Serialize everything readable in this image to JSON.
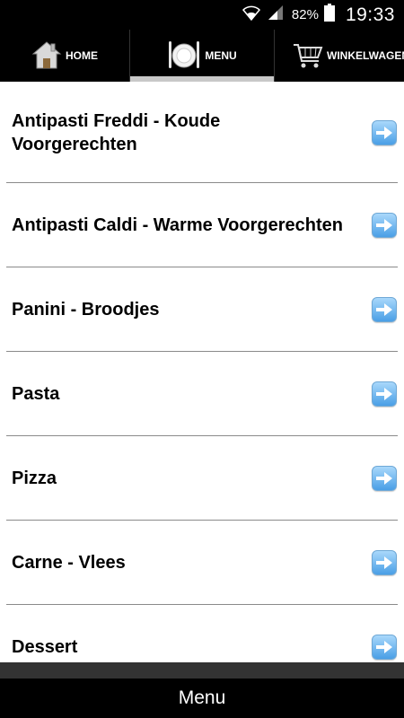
{
  "status": {
    "battery_percent": "82%",
    "time": "19:33",
    "wifi_icon": "wifi-icon",
    "signal_icon": "signal-icon",
    "battery_icon": "battery-icon"
  },
  "tabs": [
    {
      "label": "HOME",
      "icon": "house-icon"
    },
    {
      "label": "MENU",
      "icon": "plate-cutlery-icon",
      "selected": true
    },
    {
      "label": "WINKELWAGEN",
      "icon": "shopping-cart-icon"
    }
  ],
  "menu": {
    "items": [
      {
        "label": "Antipasti Freddi - Koude Voorgerechten"
      },
      {
        "label": "Antipasti Caldi - Warme Voorgerechten"
      },
      {
        "label": "Panini - Broodjes"
      },
      {
        "label": "Pasta"
      },
      {
        "label": "Pizza"
      },
      {
        "label": "Carne - Vlees"
      },
      {
        "label": "Dessert"
      }
    ],
    "item_icon": "arrow-right-icon"
  },
  "footer": {
    "title": "Menu"
  },
  "colors": {
    "bar_background": "#000000",
    "tab_indicator": "#c8c8c8",
    "arrow_button": "#4a9fe6",
    "divider": "#8a8a8a"
  }
}
